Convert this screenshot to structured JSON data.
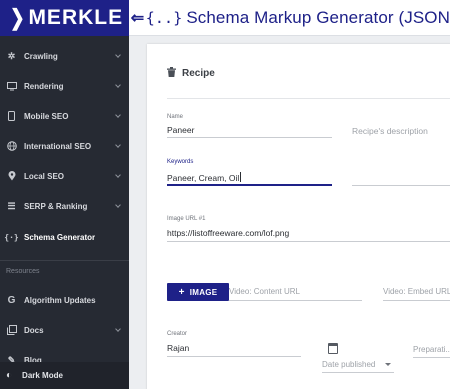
{
  "brand": {
    "logo_text": "MERKLE",
    "logo_chevron": "❯"
  },
  "header": {
    "menu_icon": "⇐",
    "title_icon": "{..}",
    "title": "Schema Markup Generator (JSON"
  },
  "sidebar": {
    "items": [
      {
        "label": "Crawling",
        "icon": "spider-icon"
      },
      {
        "label": "Rendering",
        "icon": "monitor-icon"
      },
      {
        "label": "Mobile SEO",
        "icon": "mobile-icon"
      },
      {
        "label": "International SEO",
        "icon": "globe-icon"
      },
      {
        "label": "Local SEO",
        "icon": "location-pin-icon"
      },
      {
        "label": "SERP & Ranking",
        "icon": "list-icon"
      },
      {
        "label": "Schema Generator",
        "icon": "code-braces-icon"
      }
    ],
    "resources_label": "Resources",
    "resources": [
      {
        "label": "Algorithm Updates",
        "icon": "google-icon"
      },
      {
        "label": "Docs",
        "icon": "docs-icon"
      },
      {
        "label": "Blog",
        "icon": "pen-icon"
      }
    ],
    "dark_mode_label": "Dark Mode"
  },
  "form": {
    "section_title": "Recipe",
    "name": {
      "label": "Name",
      "value": "Paneer"
    },
    "description": {
      "placeholder": "Recipe's description"
    },
    "keywords": {
      "label": "Keywords",
      "value": "Paneer, Cream, Oil"
    },
    "image_url": {
      "label": "Image URL #1",
      "value": "https://listoffreeware.com/lof.png"
    },
    "image_button": {
      "plus": "+",
      "label": "IMAGE"
    },
    "video_content_url": {
      "placeholder": "Video: Content URL"
    },
    "video_embed_url": {
      "placeholder": "Video: Embed URL"
    },
    "creator": {
      "label": "Creator",
      "value": "Rajan"
    },
    "date_published": {
      "placeholder": "Date published"
    },
    "preparation": {
      "placeholder": "Preparati..."
    }
  },
  "colors": {
    "accent": "#1e2188",
    "sidebar_bg": "#262a33"
  }
}
